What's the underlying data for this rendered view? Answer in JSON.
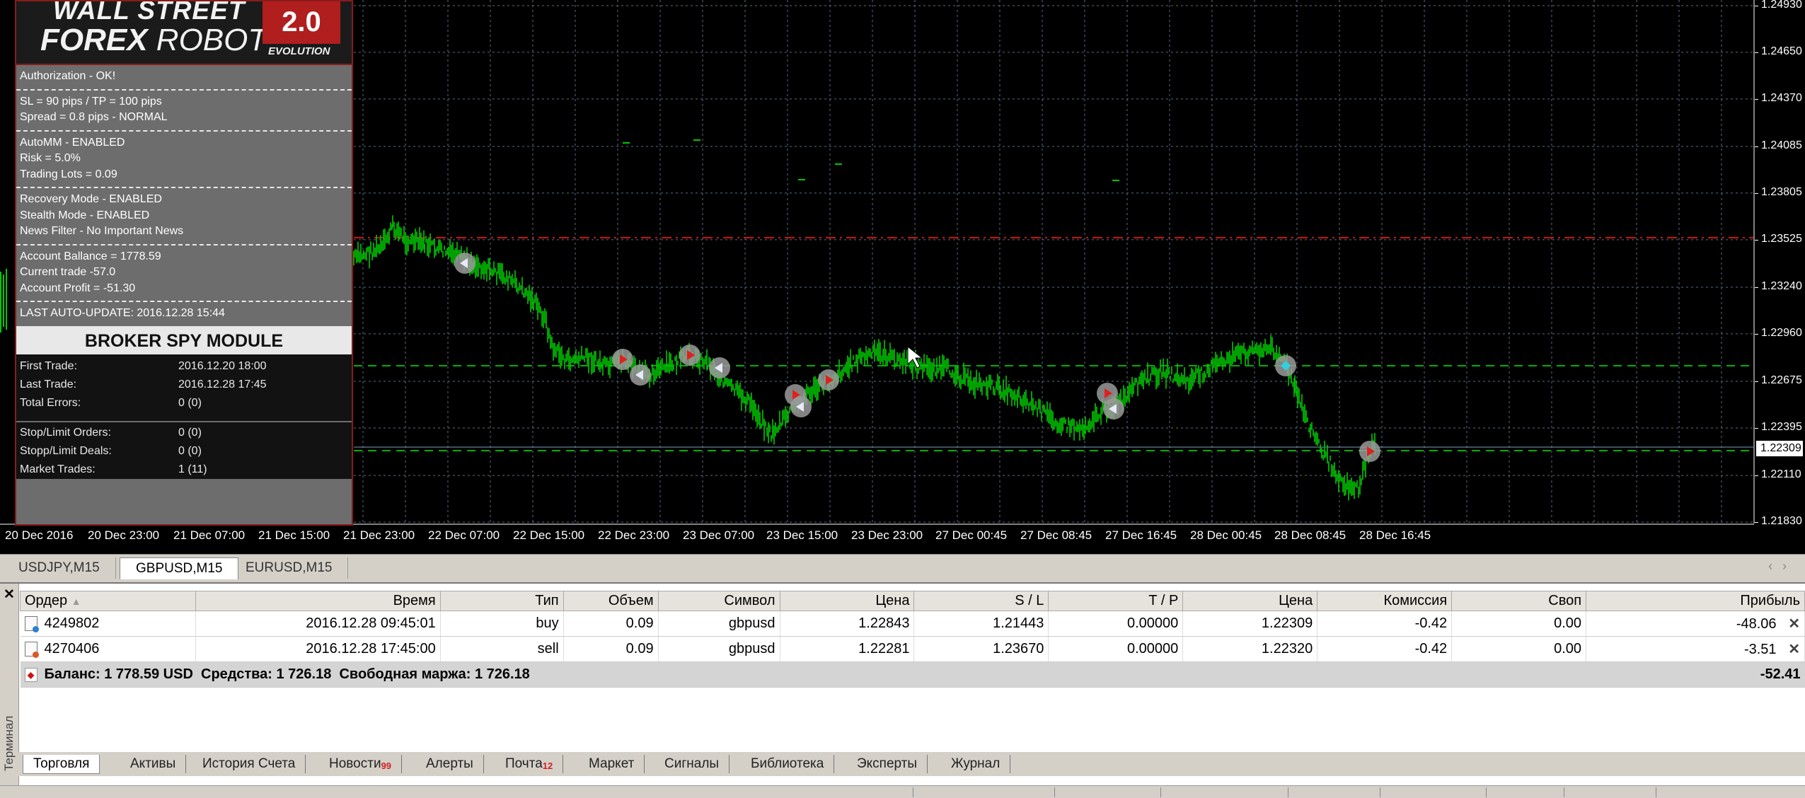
{
  "ea_panel": {
    "logo_line1": "WALL STREET",
    "logo_line2a": "FOREX",
    "logo_line2b": " ROBOT",
    "logo_version": "2.0",
    "logo_evolution": "EVOLUTION",
    "auth": "Authorization - OK!",
    "sl_tp": "SL = 90 pips / TP = 100 pips",
    "spread": "Spread = 0.8 pips - NORMAL",
    "automm": "AutoMM - ENABLED",
    "risk": "Risk = 5.0%",
    "lots": "Trading Lots = 0.09",
    "recovery": "Recovery Mode - ENABLED",
    "stealth": "Stealth Mode - ENABLED",
    "news": "News Filter - No Important News",
    "balance": "Account Ballance = 1778.59",
    "current_trade": "Current trade -57.0",
    "profit": "Account Profit = -51.30",
    "last_update": "LAST AUTO-UPDATE: 2016.12.28 15:44",
    "broker_title": "BROKER SPY MODULE",
    "first_trade_label": "First Trade:",
    "first_trade_value": "2016.12.20 18:00",
    "last_trade_label": "Last Trade:",
    "last_trade_value": "2016.12.28 17:45",
    "total_errors_label": "Total Errors:",
    "total_errors_value": "0 (0)",
    "stop_orders_label": "Stop/Limit Orders:",
    "stop_orders_value": "0 (0)",
    "stop_deals_label": "Stopp/Limit Deals:",
    "stop_deals_value": "0 (0)",
    "market_trades_label": "Market Trades:",
    "market_trades_value": "1 (11)"
  },
  "price_axis": {
    "labels": [
      "1.24930",
      "1.24650",
      "1.24370",
      "1.24085",
      "1.23805",
      "1.23525",
      "1.23240",
      "1.22960",
      "1.22675",
      "1.22395",
      "1.22110",
      "1.21830"
    ],
    "current_price": "1.22309"
  },
  "time_axis": {
    "labels": [
      "20 Dec 2016",
      "20 Dec 23:00",
      "21 Dec 07:00",
      "21 Dec 15:00",
      "21 Dec 23:00",
      "22 Dec 07:00",
      "22 Dec 15:00",
      "22 Dec 23:00",
      "23 Dec 07:00",
      "23 Dec 15:00",
      "23 Dec 23:00",
      "27 Dec 00:45",
      "27 Dec 08:45",
      "27 Dec 16:45",
      "28 Dec 00:45",
      "28 Dec 08:45",
      "28 Dec 16:45"
    ]
  },
  "chart_tabs": [
    "USDJPY,M15",
    "GBPUSD,M15",
    "EURUSD,M15"
  ],
  "terminal": {
    "side_label": "Терминал",
    "columns": [
      "Ордер",
      "Время",
      "Тип",
      "Объем",
      "Символ",
      "Цена",
      "S / L",
      "T / P",
      "Цена",
      "Комиссия",
      "Своп",
      "Прибыль"
    ],
    "rows": [
      {
        "order": "4249802",
        "time": "2016.12.28 09:45:01",
        "type": "buy",
        "volume": "0.09",
        "symbol": "gbpusd",
        "price": "1.22843",
        "sl": "1.21443",
        "tp": "0.00000",
        "cur_price": "1.22309",
        "commission": "-0.42",
        "swap": "0.00",
        "profit": "-48.06"
      },
      {
        "order": "4270406",
        "time": "2016.12.28 17:45:00",
        "type": "sell",
        "volume": "0.09",
        "symbol": "gbpusd",
        "price": "1.22281",
        "sl": "1.23670",
        "tp": "0.00000",
        "cur_price": "1.22320",
        "commission": "-0.42",
        "swap": "0.00",
        "profit": "-3.51"
      }
    ],
    "summary": "Баланс: 1 778.59 USD  Средства: 1 726.18  Свободная маржа: 1 726.18",
    "summary_profit": "-52.41",
    "tabs": [
      "Торговля",
      "Активы",
      "История Счета",
      "Новости",
      "Алерты",
      "Почта",
      "Маркет",
      "Сигналы",
      "Библиотека",
      "Эксперты",
      "Журнал"
    ],
    "news_badge": "99",
    "mail_badge": "12"
  },
  "colors": {
    "candles": "#00c800",
    "grid": "#5a6e82",
    "red_line": "#d01010",
    "green_line": "#00b000"
  }
}
